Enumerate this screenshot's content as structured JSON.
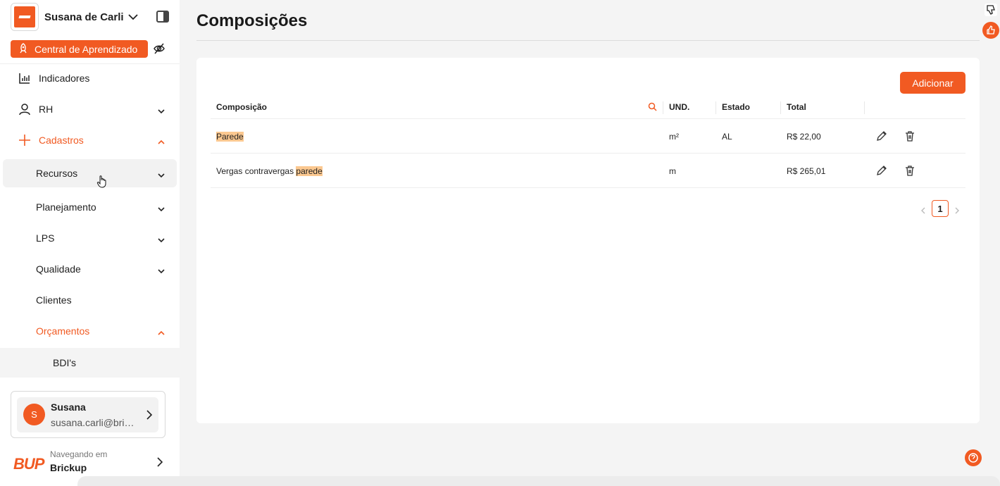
{
  "org": {
    "name": "Susana de Carli",
    "icon": "brickup-logo"
  },
  "learning": {
    "label": "Central de Aprendizado",
    "icon": "rocket-icon"
  },
  "nav": {
    "indicadores": "Indicadores",
    "rh": "RH",
    "cadastros": "Cadastros",
    "recursos": "Recursos",
    "planejamento": "Planejamento",
    "lps": "LPS",
    "qualidade": "Qualidade",
    "clientes": "Clientes",
    "orcamentos": "Orçamentos",
    "bdis": "BDI's"
  },
  "user": {
    "initial": "S",
    "name": "Susana",
    "email": "susana.carli@brickup.com.br"
  },
  "workspace": {
    "logo_text": "BUP",
    "subtitle": "Navegando em",
    "name": "Brickup"
  },
  "page": {
    "title": "Composições",
    "add_label": "Adicionar"
  },
  "table": {
    "headers": {
      "composicao": "Composição",
      "und": "UND.",
      "estado": "Estado",
      "total": "Total"
    },
    "rows": [
      {
        "prefix": "",
        "highlight": "Parede",
        "und": "m²",
        "estado": "AL",
        "total": "R$ 22,00"
      },
      {
        "prefix": "Vergas contravergas ",
        "highlight": "parede",
        "und": "m",
        "estado": "",
        "total": "R$ 265,01"
      }
    ]
  },
  "pagination": {
    "current": "1"
  },
  "colors": {
    "accent": "#f15a22",
    "highlight": "#fbc890"
  }
}
